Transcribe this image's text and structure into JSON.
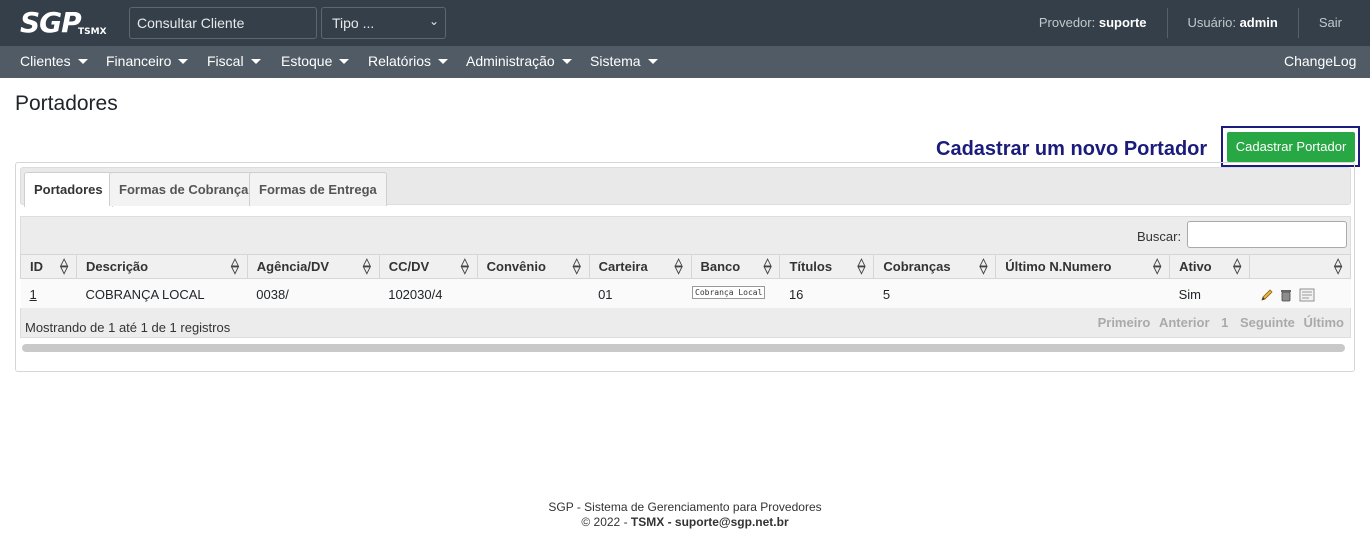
{
  "brand": {
    "logo": "SGP",
    "logo_sub": "TSMX"
  },
  "search": {
    "client_placeholder": "Consultar Cliente",
    "type_select": "Tipo ..."
  },
  "session": {
    "provider_label": "Provedor:",
    "provider_value": "suporte",
    "user_label": "Usuário:",
    "user_value": "admin",
    "logout": "Sair"
  },
  "nav": {
    "items": [
      "Clientes",
      "Financeiro",
      "Fiscal",
      "Estoque",
      "Relatórios",
      "Administração",
      "Sistema"
    ],
    "changelog": "ChangeLog"
  },
  "page": {
    "title": "Portadores",
    "hint": "Cadastrar um novo Portador",
    "new_button": "Cadastrar Portador"
  },
  "tabs": [
    "Portadores",
    "Formas de Cobrança",
    "Formas de Entrega"
  ],
  "table": {
    "search_label": "Buscar:",
    "columns": [
      "ID",
      "Descrição",
      "Agência/DV",
      "CC/DV",
      "Convênio",
      "Carteira",
      "Banco",
      "Títulos",
      "Cobranças",
      "Último N.Numero",
      "Ativo",
      ""
    ],
    "rows": [
      {
        "id": "1",
        "descricao": "COBRANÇA LOCAL",
        "agencia": "0038/",
        "cc": "102030/4",
        "convenio": "",
        "carteira": "01",
        "banco": "Cobrança Local",
        "titulos": "16",
        "cobrancas": "5",
        "ultimo": "",
        "ativo": "Sim"
      }
    ],
    "info": "Mostrando de 1 até 1 de 1 registros",
    "pager": {
      "first": "Primeiro",
      "prev": "Anterior",
      "page": "1",
      "next": "Seguinte",
      "last": "Último"
    }
  },
  "footer": {
    "line1": "SGP - Sistema de Gerenciamento para Provedores",
    "copy": "© 2022 -",
    "company": "TSMX - suporte@sgp.net.br"
  },
  "colors": {
    "topbar": "#343f49",
    "navbar": "#505b66",
    "primary_button": "#28a745",
    "hint": "#1b1b7c"
  }
}
